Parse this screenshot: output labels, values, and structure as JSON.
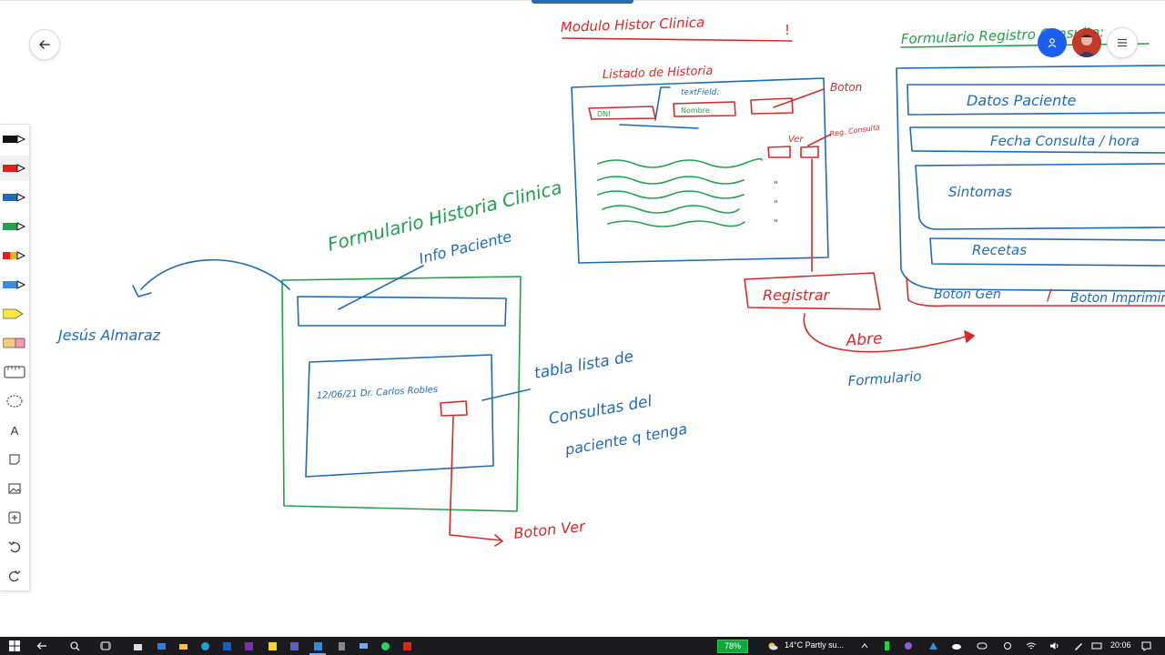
{
  "colors": {
    "red": "#d62a2a",
    "blue": "#1f6bb8",
    "green": "#22a04a",
    "taskbar": "#1b1b1f"
  },
  "header": {
    "back_icon": "arrow-left-icon",
    "participant_icon": "person-icon",
    "menu_icon": "hamburger-icon"
  },
  "toolbar": {
    "tools": [
      {
        "name": "pen-black",
        "color": "#111111"
      },
      {
        "name": "pen-red",
        "color": "#e02020"
      },
      {
        "name": "pen-blue",
        "color": "#1f6bb8"
      },
      {
        "name": "pen-green",
        "color": "#21a050"
      },
      {
        "name": "pen-multicolor",
        "color": "#e0a020"
      },
      {
        "name": "pen-light-blue",
        "color": "#3a8ee0"
      },
      {
        "name": "highlighter-yellow",
        "color": "#f5e642"
      },
      {
        "name": "eraser",
        "color": "#f0b040"
      }
    ],
    "text_tool_label": "A"
  },
  "sketch": {
    "modulo_title": "Modulo Histor Clinica",
    "modulo_bang": "!",
    "listado": "Listado de Historia",
    "textfield": "textField:",
    "dni": "DNI",
    "nombre": "Nombre",
    "boton": "Boton",
    "ver": "Ver",
    "reg_consulta": "Reg. Consulta",
    "ditto1": "\"",
    "ditto2": "\"",
    "ditto3": "\"",
    "registrar": "Registrar",
    "abre": "Abre",
    "formulario": "Formulario",
    "form_reg_title": "Formulario Registro Consulta:",
    "datos_paciente": "Datos Paciente",
    "fecha_consulta": "Fecha Consulta / hora",
    "sintomas": "Sintomas",
    "recetas": "Recetas",
    "boton_gen": "Boton Gen",
    "slash": "/",
    "boton_impr": "Boton Imprimir",
    "formulario_historia": "Formulario Historia Clinica",
    "info_paciente": "Info Paciente",
    "jesus": "Jesús Almaraz",
    "row_text": "12/06/21 Dr. Carlos Robles",
    "tabla_line1": "tabla lista de",
    "tabla_line2": "Consultas del",
    "tabla_line3": "paciente q tenga",
    "boton_ver": "Boton Ver"
  },
  "taskbar": {
    "battery": "78%",
    "weather": "14°C  Partly su...",
    "time": "20:06"
  }
}
